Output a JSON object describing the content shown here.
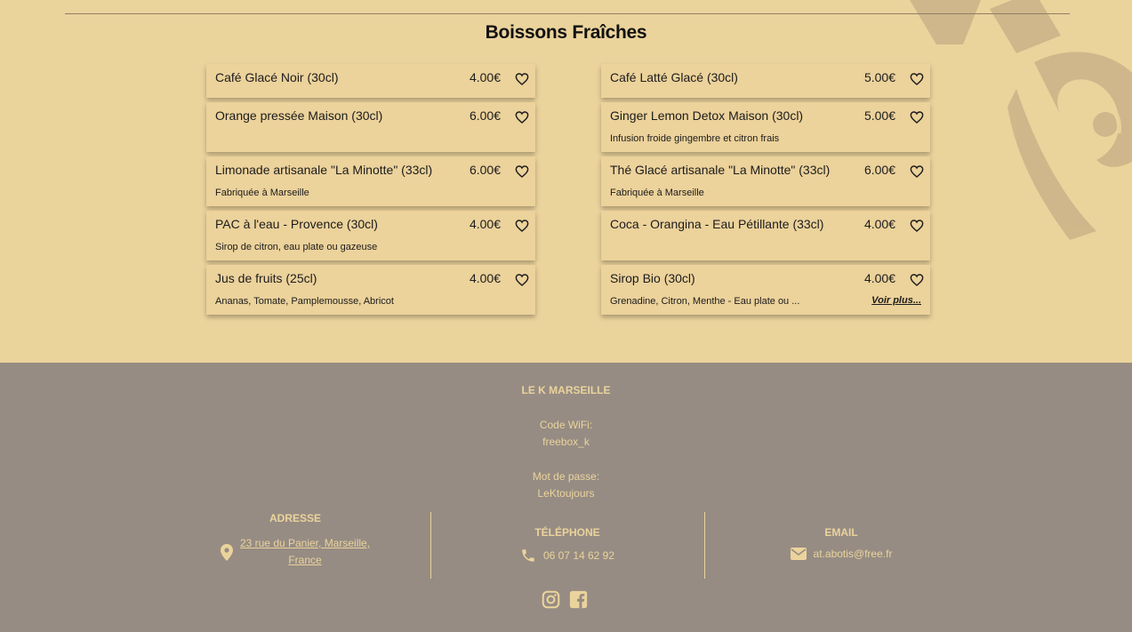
{
  "section": {
    "title": "Boissons Fraîches"
  },
  "drinks_left": [
    {
      "name": "Café Glacé Noir (30cl)",
      "price": "4.00€",
      "desc": ""
    },
    {
      "name": "Orange pressée Maison (30cl)",
      "price": "6.00€",
      "desc": ""
    },
    {
      "name": "Limonade artisanale \"La Minotte\" (33cl)",
      "price": "6.00€",
      "desc": "Fabriquée à Marseille"
    },
    {
      "name": "PAC à l'eau - Provence (30cl)",
      "price": "4.00€",
      "desc": "Sirop de citron, eau plate ou gazeuse"
    },
    {
      "name": "Jus de fruits (25cl)",
      "price": "4.00€",
      "desc": "Ananas, Tomate, Pamplemousse, Abricot"
    }
  ],
  "drinks_right": [
    {
      "name": "Café Latté Glacé (30cl)",
      "price": "5.00€",
      "desc": ""
    },
    {
      "name": "Ginger Lemon Detox Maison (30cl)",
      "price": "5.00€",
      "desc": "Infusion froide gingembre et citron frais"
    },
    {
      "name": "Thé Glacé artisanale \"La Minotte\" (33cl)",
      "price": "6.00€",
      "desc": "Fabriquée à Marseille"
    },
    {
      "name": "Coca - Orangina - Eau Pétillante (33cl)",
      "price": "4.00€",
      "desc": ""
    },
    {
      "name": "Sirop Bio (30cl)",
      "price": "4.00€",
      "desc": "Grenadine, Citron, Menthe - Eau plate ou ...",
      "more": "Voir plus..."
    }
  ],
  "footer": {
    "brand": "LE K MARSEILLE",
    "wifi_label": "Code WiFi:",
    "wifi_value": "freebox_k",
    "password_label": "Mot de passe:",
    "password_value": "LeKtoujours",
    "address_title": "ADRESSE",
    "address_line1": "23 rue du Panier, Marseille,",
    "address_line2": "France",
    "phone_title": "TÉLÉPHONE",
    "phone_value": "06 07 14 62 92",
    "email_title": "EMAIL",
    "email_value": "at.abotis@free.fr"
  },
  "icons": {
    "heart": "heart-icon",
    "location": "map-pin-icon",
    "phone": "phone-icon",
    "email": "envelope-icon",
    "instagram": "instagram-icon",
    "facebook": "facebook-icon"
  },
  "colors": {
    "background": "#ebd39c",
    "footer": "#968c83",
    "footer_text": "#ebd39c"
  }
}
